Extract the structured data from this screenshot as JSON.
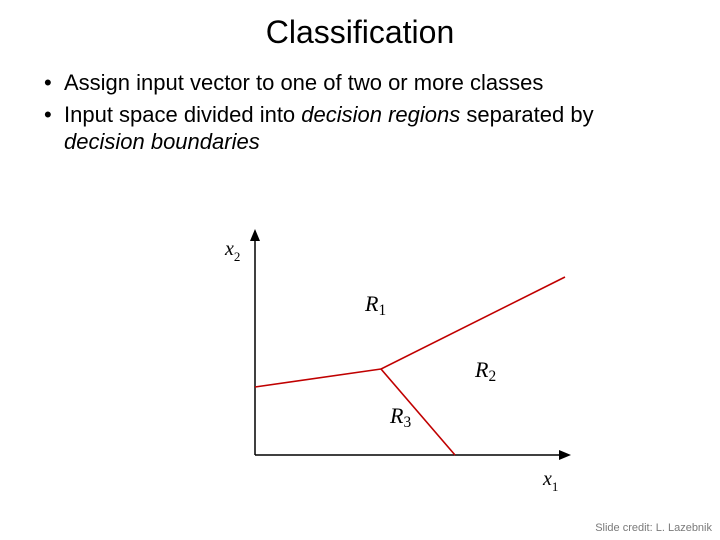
{
  "title": "Classification",
  "bullets": {
    "b1_a": "Assign input vector to one of two or more classes",
    "b2_a": "Input space divided into ",
    "b2_i1": "decision regions",
    "b2_b": " separated by ",
    "b2_i2": "decision boundaries"
  },
  "axes": {
    "x": "x",
    "x_sub": "1",
    "y": "x",
    "y_sub": "2"
  },
  "regions": {
    "r1": {
      "R": "R",
      "n": "1"
    },
    "r2": {
      "R": "R",
      "n": "2"
    },
    "r3": {
      "R": "R",
      "n": "3"
    }
  },
  "credit": "Slide credit: L. Lazebnik",
  "chart_data": {
    "type": "line",
    "title": "Decision regions and boundaries",
    "xlabel": "x1",
    "ylabel": "x2",
    "xlim": [
      0,
      310
    ],
    "ylim": [
      0,
      220
    ],
    "axes_origin": [
      60,
      240
    ],
    "decision_boundaries": [
      {
        "from": [
          60,
          172
        ],
        "to": [
          186,
          154
        ]
      },
      {
        "from": [
          186,
          154
        ],
        "to": [
          260,
          240
        ]
      },
      {
        "from": [
          186,
          154
        ],
        "to": [
          370,
          62
        ]
      }
    ],
    "region_label_positions": {
      "R1": [
        170,
        96
      ],
      "R2": [
        280,
        162
      ],
      "R3": [
        195,
        208
      ]
    }
  }
}
